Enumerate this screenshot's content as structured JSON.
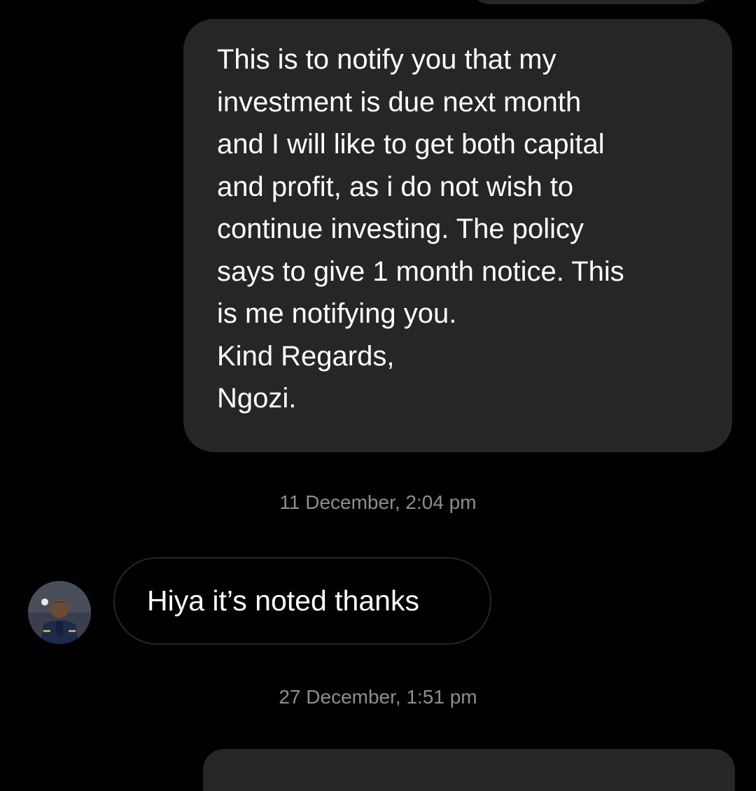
{
  "messages": {
    "sent_main": {
      "text": "This is to notify you that my\ninvestment is due next month\nand I will like to get both capital\nand profit, as i do not wish to\ncontinue investing. The policy\nsays to give 1 month notice. This\nis me notifying you.\nKind Regards,\nNgozi."
    },
    "timestamp_1": "11 December, 2:04 pm",
    "received": {
      "text": "Hiya it’s noted thanks"
    },
    "timestamp_2": "27 December, 1:51 pm"
  },
  "colors": {
    "background": "#000000",
    "sent_bubble": "#262626",
    "received_bubble_border": "#262626",
    "timestamp_text": "#8e8e8e",
    "message_text": "#ffffff"
  }
}
